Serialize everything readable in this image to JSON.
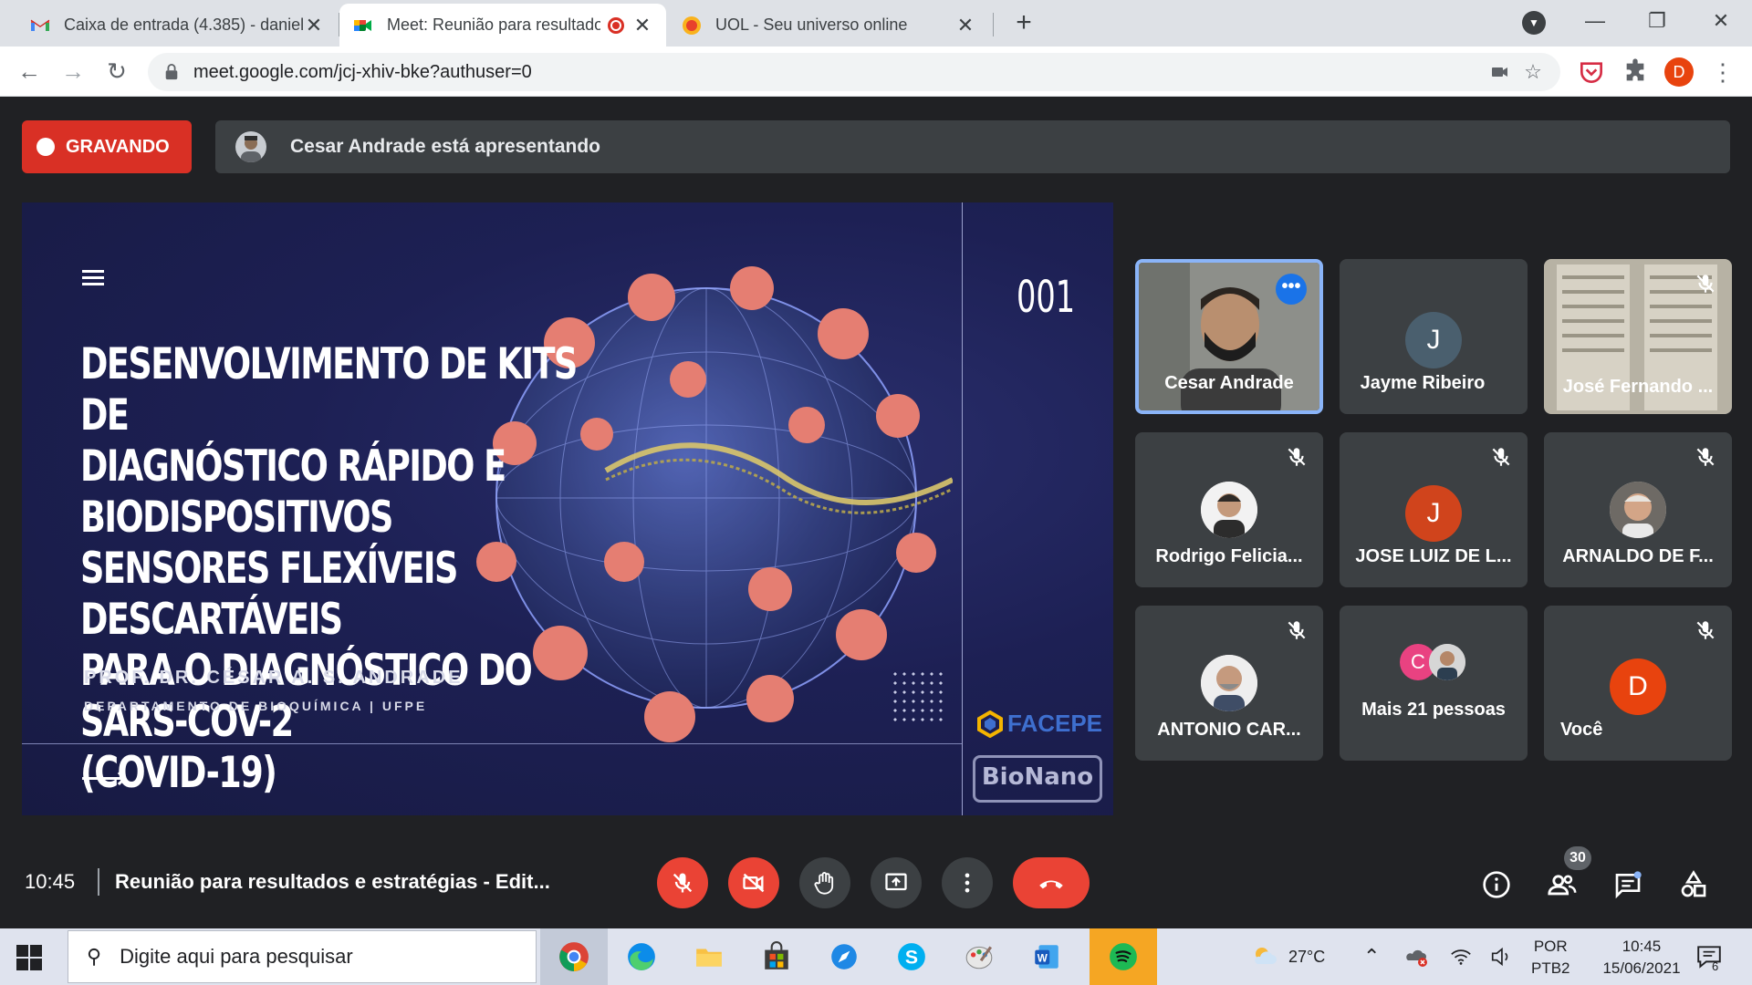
{
  "browser": {
    "tabs": [
      {
        "title": "Caixa de entrada (4.385) - daniel",
        "icon": "gmail-icon"
      },
      {
        "title": "Meet: Reunião para resultado",
        "icon": "google-meet-icon",
        "active": true,
        "recording": true
      },
      {
        "title": "UOL - Seu universo online",
        "icon": "uol-icon"
      }
    ],
    "url": "meet.google.com/jcj-xhiv-bke?authuser=0",
    "profile_initial": "D",
    "colors": {
      "tabbar": "#dee1e6",
      "accent": "#1a73e8",
      "profile": "#e8430e"
    }
  },
  "meet": {
    "recording_label": "GRAVANDO",
    "presenter_text": "Cesar Andrade está apresentando",
    "slide": {
      "title": "Desenvolvimento de kits de diagnóstico rápido e biodispositivos sensores flexíveis descartáveis para o diagnóstico do SARS-CoV-2 (COVID-19)",
      "title_lines": [
        "DESENVOLVIMENTO DE KITS DE",
        "DIAGNÓSTICO RÁPIDO E BIODISPOSITIVOS",
        "SENSORES FLEXÍVEIS DESCARTÁVEIS",
        "PARA O DIAGNÓSTICO DO SARS-CoV-2",
        "(COVID-19)"
      ],
      "number": "001",
      "author": "PROF. DR. CÉSAR A. S. ANDRADE",
      "department": "DEPARTAMENTO DE BIOQUÍMICA | UFPE",
      "logo_facepe": "FACEPE",
      "logo_bionano": "BioNano",
      "arrow": "⟶"
    },
    "participants": [
      {
        "name": "Cesar Andrade",
        "type": "video",
        "speaking": true
      },
      {
        "name": "Jayme Ribeiro",
        "type": "letter",
        "letter": "J",
        "color": "#4a5f6e"
      },
      {
        "name": "José Fernando ...",
        "type": "video",
        "muted": true
      },
      {
        "name": "Rodrigo Felicia...",
        "type": "photo",
        "muted": true
      },
      {
        "name": "JOSE LUIZ DE L...",
        "type": "letter",
        "letter": "J",
        "color": "#d0441c",
        "muted": true
      },
      {
        "name": "ARNALDO DE F...",
        "type": "photo",
        "muted": true
      },
      {
        "name": "ANTONIO CAR...",
        "type": "photo",
        "muted": true
      },
      {
        "name": "Mais 21 pessoas",
        "type": "group",
        "letter": "C",
        "color": "#e94281"
      },
      {
        "name": "Você",
        "type": "letter",
        "letter": "D",
        "color": "#e8430e",
        "muted": true
      }
    ],
    "bottom": {
      "time": "10:45",
      "meeting_title": "Reunião para resultados e estratégias - Edit...",
      "participants_count": "30"
    }
  },
  "taskbar": {
    "search_placeholder": "Digite aqui para pesquisar",
    "weather": "27°C",
    "lang_line1": "POR",
    "lang_line2": "PTB2",
    "time": "10:45",
    "date": "15/06/2021",
    "notifications": "6"
  }
}
